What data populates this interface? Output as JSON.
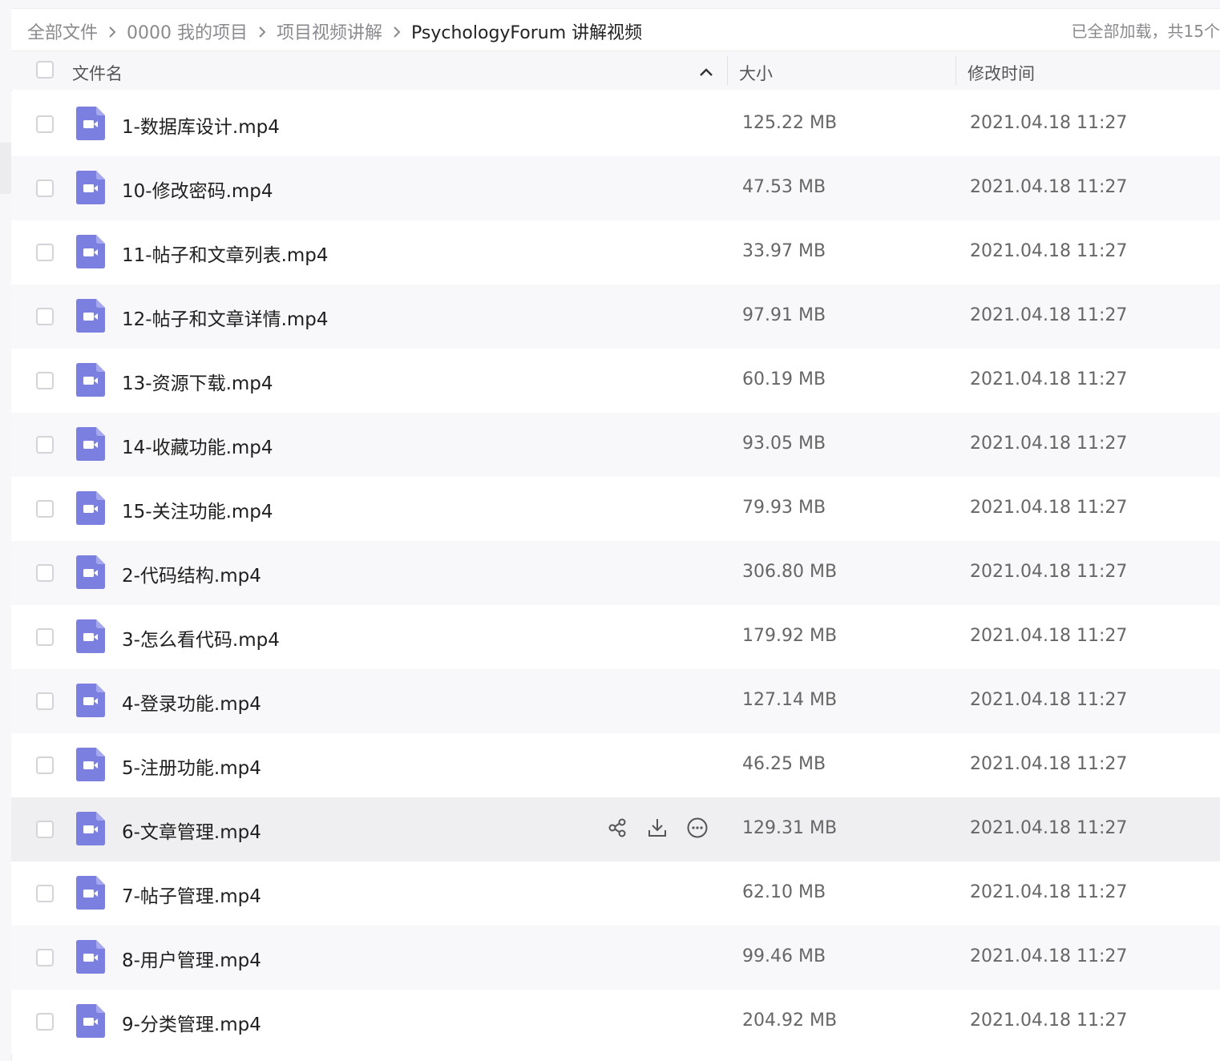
{
  "breadcrumb": {
    "items": [
      "全部文件",
      "0000 我的项目",
      "项目视频讲解",
      "PsychologyForum 讲解视频"
    ],
    "status": "已全部加载，共15个"
  },
  "table": {
    "headers": {
      "name": "文件名",
      "size": "大小",
      "modified": "修改时间"
    },
    "rows": [
      {
        "name": "1-数据库设计.mp4",
        "size": "125.22 MB",
        "modified": "2021.04.18 11:27"
      },
      {
        "name": "10-修改密码.mp4",
        "size": "47.53 MB",
        "modified": "2021.04.18 11:27"
      },
      {
        "name": "11-帖子和文章列表.mp4",
        "size": "33.97 MB",
        "modified": "2021.04.18 11:27"
      },
      {
        "name": "12-帖子和文章详情.mp4",
        "size": "97.91 MB",
        "modified": "2021.04.18 11:27"
      },
      {
        "name": "13-资源下载.mp4",
        "size": "60.19 MB",
        "modified": "2021.04.18 11:27"
      },
      {
        "name": "14-收藏功能.mp4",
        "size": "93.05 MB",
        "modified": "2021.04.18 11:27"
      },
      {
        "name": "15-关注功能.mp4",
        "size": "79.93 MB",
        "modified": "2021.04.18 11:27"
      },
      {
        "name": "2-代码结构.mp4",
        "size": "306.80 MB",
        "modified": "2021.04.18 11:27"
      },
      {
        "name": "3-怎么看代码.mp4",
        "size": "179.92 MB",
        "modified": "2021.04.18 11:27"
      },
      {
        "name": "4-登录功能.mp4",
        "size": "127.14 MB",
        "modified": "2021.04.18 11:27"
      },
      {
        "name": "5-注册功能.mp4",
        "size": "46.25 MB",
        "modified": "2021.04.18 11:27"
      },
      {
        "name": "6-文章管理.mp4",
        "size": "129.31 MB",
        "modified": "2021.04.18 11:27"
      },
      {
        "name": "7-帖子管理.mp4",
        "size": "62.10 MB",
        "modified": "2021.04.18 11:27"
      },
      {
        "name": "8-用户管理.mp4",
        "size": "99.46 MB",
        "modified": "2021.04.18 11:27"
      },
      {
        "name": "9-分类管理.mp4",
        "size": "204.92 MB",
        "modified": "2021.04.18 11:27"
      }
    ],
    "hovered_row_index": 11,
    "row_actions": [
      "share-icon",
      "download-icon",
      "more-icon"
    ]
  },
  "icons": {
    "file_type": "video-file-icon",
    "sort": "chevron-up-icon",
    "separator": "chevron-right-icon"
  },
  "colors": {
    "file_icon": "#7b7fe0",
    "row_alt": "#f8f8fa",
    "row_hover": "#efeff2"
  }
}
